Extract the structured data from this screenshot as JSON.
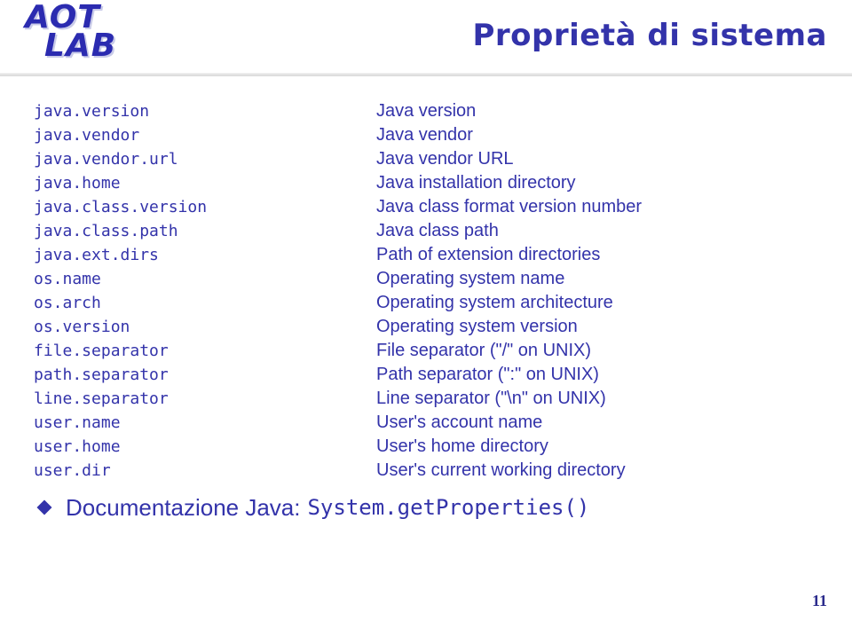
{
  "slide": {
    "logo": {
      "line1": "AOT",
      "line2": "LAB"
    },
    "title": "Proprietà di sistema",
    "page_number": "11",
    "accent_color": "#3333aa",
    "rule_color": "#e3e3e3"
  },
  "properties": [
    {
      "key": "java.version",
      "desc": "Java version"
    },
    {
      "key": "java.vendor",
      "desc": "Java vendor"
    },
    {
      "key": "java.vendor.url",
      "desc": "Java vendor URL"
    },
    {
      "key": "java.home",
      "desc": "Java installation directory"
    },
    {
      "key": "java.class.version",
      "desc": "Java class format version number"
    },
    {
      "key": "java.class.path",
      "desc": "Java class path"
    },
    {
      "key": "java.ext.dirs",
      "desc": "Path of extension directories"
    },
    {
      "key": "os.name",
      "desc": "Operating system name"
    },
    {
      "key": "os.arch",
      "desc": "Operating system architecture"
    },
    {
      "key": "os.version",
      "desc": "Operating system version"
    },
    {
      "key": "file.separator",
      "desc": "File separator (\"/\" on UNIX)"
    },
    {
      "key": "path.separator",
      "desc": "Path separator (\":\" on UNIX)"
    },
    {
      "key": "line.separator",
      "desc": "Line separator (\"\\n\" on UNIX)"
    },
    {
      "key": "user.name",
      "desc": "User's account name"
    },
    {
      "key": "user.home",
      "desc": "User's home directory"
    },
    {
      "key": "user.dir",
      "desc": "User's current working directory"
    }
  ],
  "footer_bullet": {
    "marker": "diamond-bullet-icon",
    "text": "Documentazione Java:",
    "code": "System.getProperties()"
  }
}
